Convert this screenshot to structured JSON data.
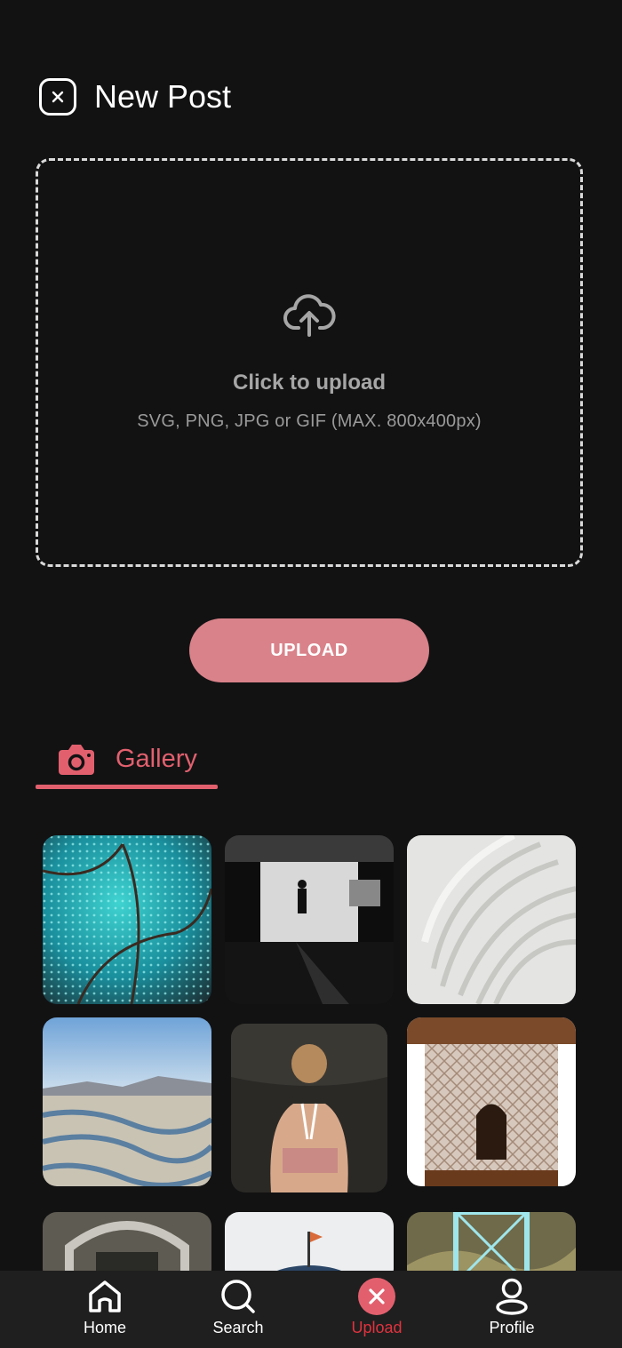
{
  "header": {
    "title": "New Post",
    "close_icon": "close-icon"
  },
  "dropzone": {
    "icon": "cloud-upload-icon",
    "title": "Click to upload",
    "subtitle": "SVG, PNG, JPG or GIF (MAX. 800x400px)"
  },
  "upload_button": {
    "label": "UPLOAD"
  },
  "gallery_tab": {
    "label": "Gallery",
    "icon": "camera-icon"
  },
  "colors": {
    "background": "#121213",
    "accent": "#e2606e",
    "button": "#d9828a",
    "nav_active": "#e0333f"
  },
  "nav": {
    "items": [
      {
        "label": "Home",
        "icon": "home-icon"
      },
      {
        "label": "Search",
        "icon": "search-icon"
      },
      {
        "label": "Upload",
        "icon": "close-circle-icon",
        "active": true
      },
      {
        "label": "Profile",
        "icon": "user-icon"
      }
    ]
  }
}
